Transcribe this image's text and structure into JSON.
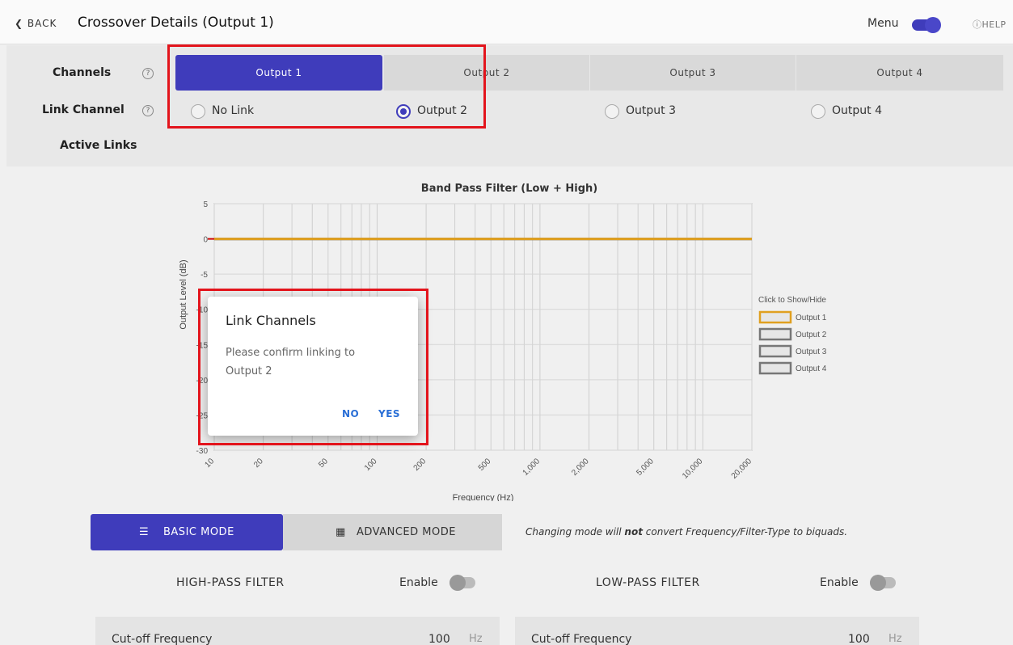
{
  "header": {
    "back_label": "BACK",
    "title": "Crossover Details (Output 1)",
    "menu_label": "Menu",
    "help_label": "HELP"
  },
  "channels": {
    "label": "Channels",
    "tabs": [
      {
        "label": "Output 1",
        "active": true
      },
      {
        "label": "Output 2",
        "active": false
      },
      {
        "label": "Output 3",
        "active": false
      },
      {
        "label": "Output 4",
        "active": false
      }
    ]
  },
  "link_channel": {
    "label": "Link Channel",
    "options": [
      {
        "label": "No Link",
        "checked": false
      },
      {
        "label": "Output 2",
        "checked": true
      },
      {
        "label": "Output 3",
        "checked": false
      },
      {
        "label": "Output 4",
        "checked": false
      }
    ]
  },
  "active_links": {
    "label": "Active Links"
  },
  "chart_data": {
    "type": "line",
    "title": "Band Pass Filter (Low + High)",
    "xlabel": "Frequency (Hz)",
    "ylabel": "Output Level (dB)",
    "x_scale": "log",
    "xlim": [
      10,
      20000
    ],
    "ylim": [
      -30,
      5
    ],
    "x_ticks": [
      "10",
      "20",
      "50",
      "100",
      "200",
      "500",
      "1,000",
      "2,000",
      "5,000",
      "10,000",
      "20,000"
    ],
    "y_ticks": [
      "5",
      "0",
      "-5",
      "-10",
      "-15",
      "-20",
      "-25",
      "-30"
    ],
    "legend_title": "Click to Show/Hide",
    "legend_position": "right",
    "series": [
      {
        "name": "Output 1",
        "color": "#e0a020",
        "x": [
          10,
          20000
        ],
        "values": [
          0,
          0
        ]
      },
      {
        "name": "Output 2",
        "color": "#777777",
        "x": [
          10,
          20000
        ],
        "values": [
          0,
          0
        ]
      },
      {
        "name": "Output 3",
        "color": "#777777",
        "x": [
          10,
          20000
        ],
        "values": [
          0,
          0
        ]
      },
      {
        "name": "Output 4",
        "color": "#777777",
        "x": [
          10,
          20000
        ],
        "values": [
          0,
          0
        ]
      }
    ]
  },
  "dialog": {
    "title": "Link Channels",
    "message": "Please confirm linking to Output 2",
    "no_label": "NO",
    "yes_label": "YES"
  },
  "mode": {
    "basic_label": "BASIC MODE",
    "advanced_label": "ADVANCED MODE",
    "note_before": "Changing mode will ",
    "note_bold": "not",
    "note_after": " convert Frequency/Filter-Type to biquads."
  },
  "high_pass": {
    "title": "HIGH-PASS FILTER",
    "enable_label": "Enable",
    "cutoff_label": "Cut-off Frequency",
    "cutoff_value": "100",
    "cutoff_unit": "Hz"
  },
  "low_pass": {
    "title": "LOW-PASS FILTER",
    "enable_label": "Enable",
    "cutoff_label": "Cut-off Frequency",
    "cutoff_value": "100",
    "cutoff_unit": "Hz"
  },
  "colors": {
    "accent": "#3f3cbb",
    "highlight": "#e3141c",
    "series_active": "#e0a020",
    "dialog_button": "#2a6fd6"
  }
}
